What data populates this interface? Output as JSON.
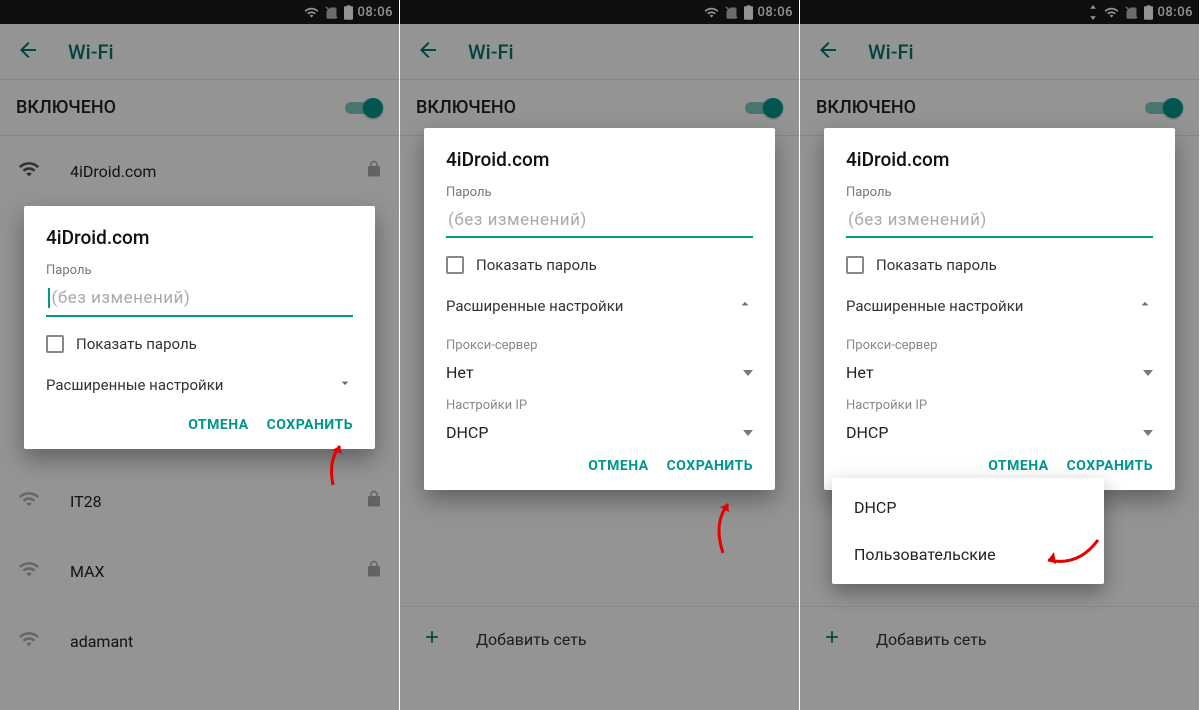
{
  "status": {
    "time": "08:06"
  },
  "appbar": {
    "title": "Wi-Fi"
  },
  "toggle": {
    "label": "ВКЛЮЧЕНО"
  },
  "networks": [
    {
      "ssid": "4iDroid.com",
      "locked": true
    },
    {
      "ssid": "IT28",
      "locked": true
    },
    {
      "ssid": "MAX",
      "locked": true
    },
    {
      "ssid": "adamant",
      "locked": false
    }
  ],
  "add_network": "Добавить сеть",
  "dialog": {
    "network": "4iDroid.com",
    "password_label": "Пароль",
    "password_placeholder": "(без изменений)",
    "show_password": "Показать пароль",
    "advanced": "Расширенные настройки",
    "proxy_label": "Прокси-сервер",
    "proxy_value": "Нет",
    "ip_label": "Настройки IP",
    "ip_value": "DHCP",
    "ip_options": [
      "DHCP",
      "Пользовательские"
    ],
    "cancel": "ОТМЕНА",
    "save": "СОХРАНИТЬ"
  }
}
